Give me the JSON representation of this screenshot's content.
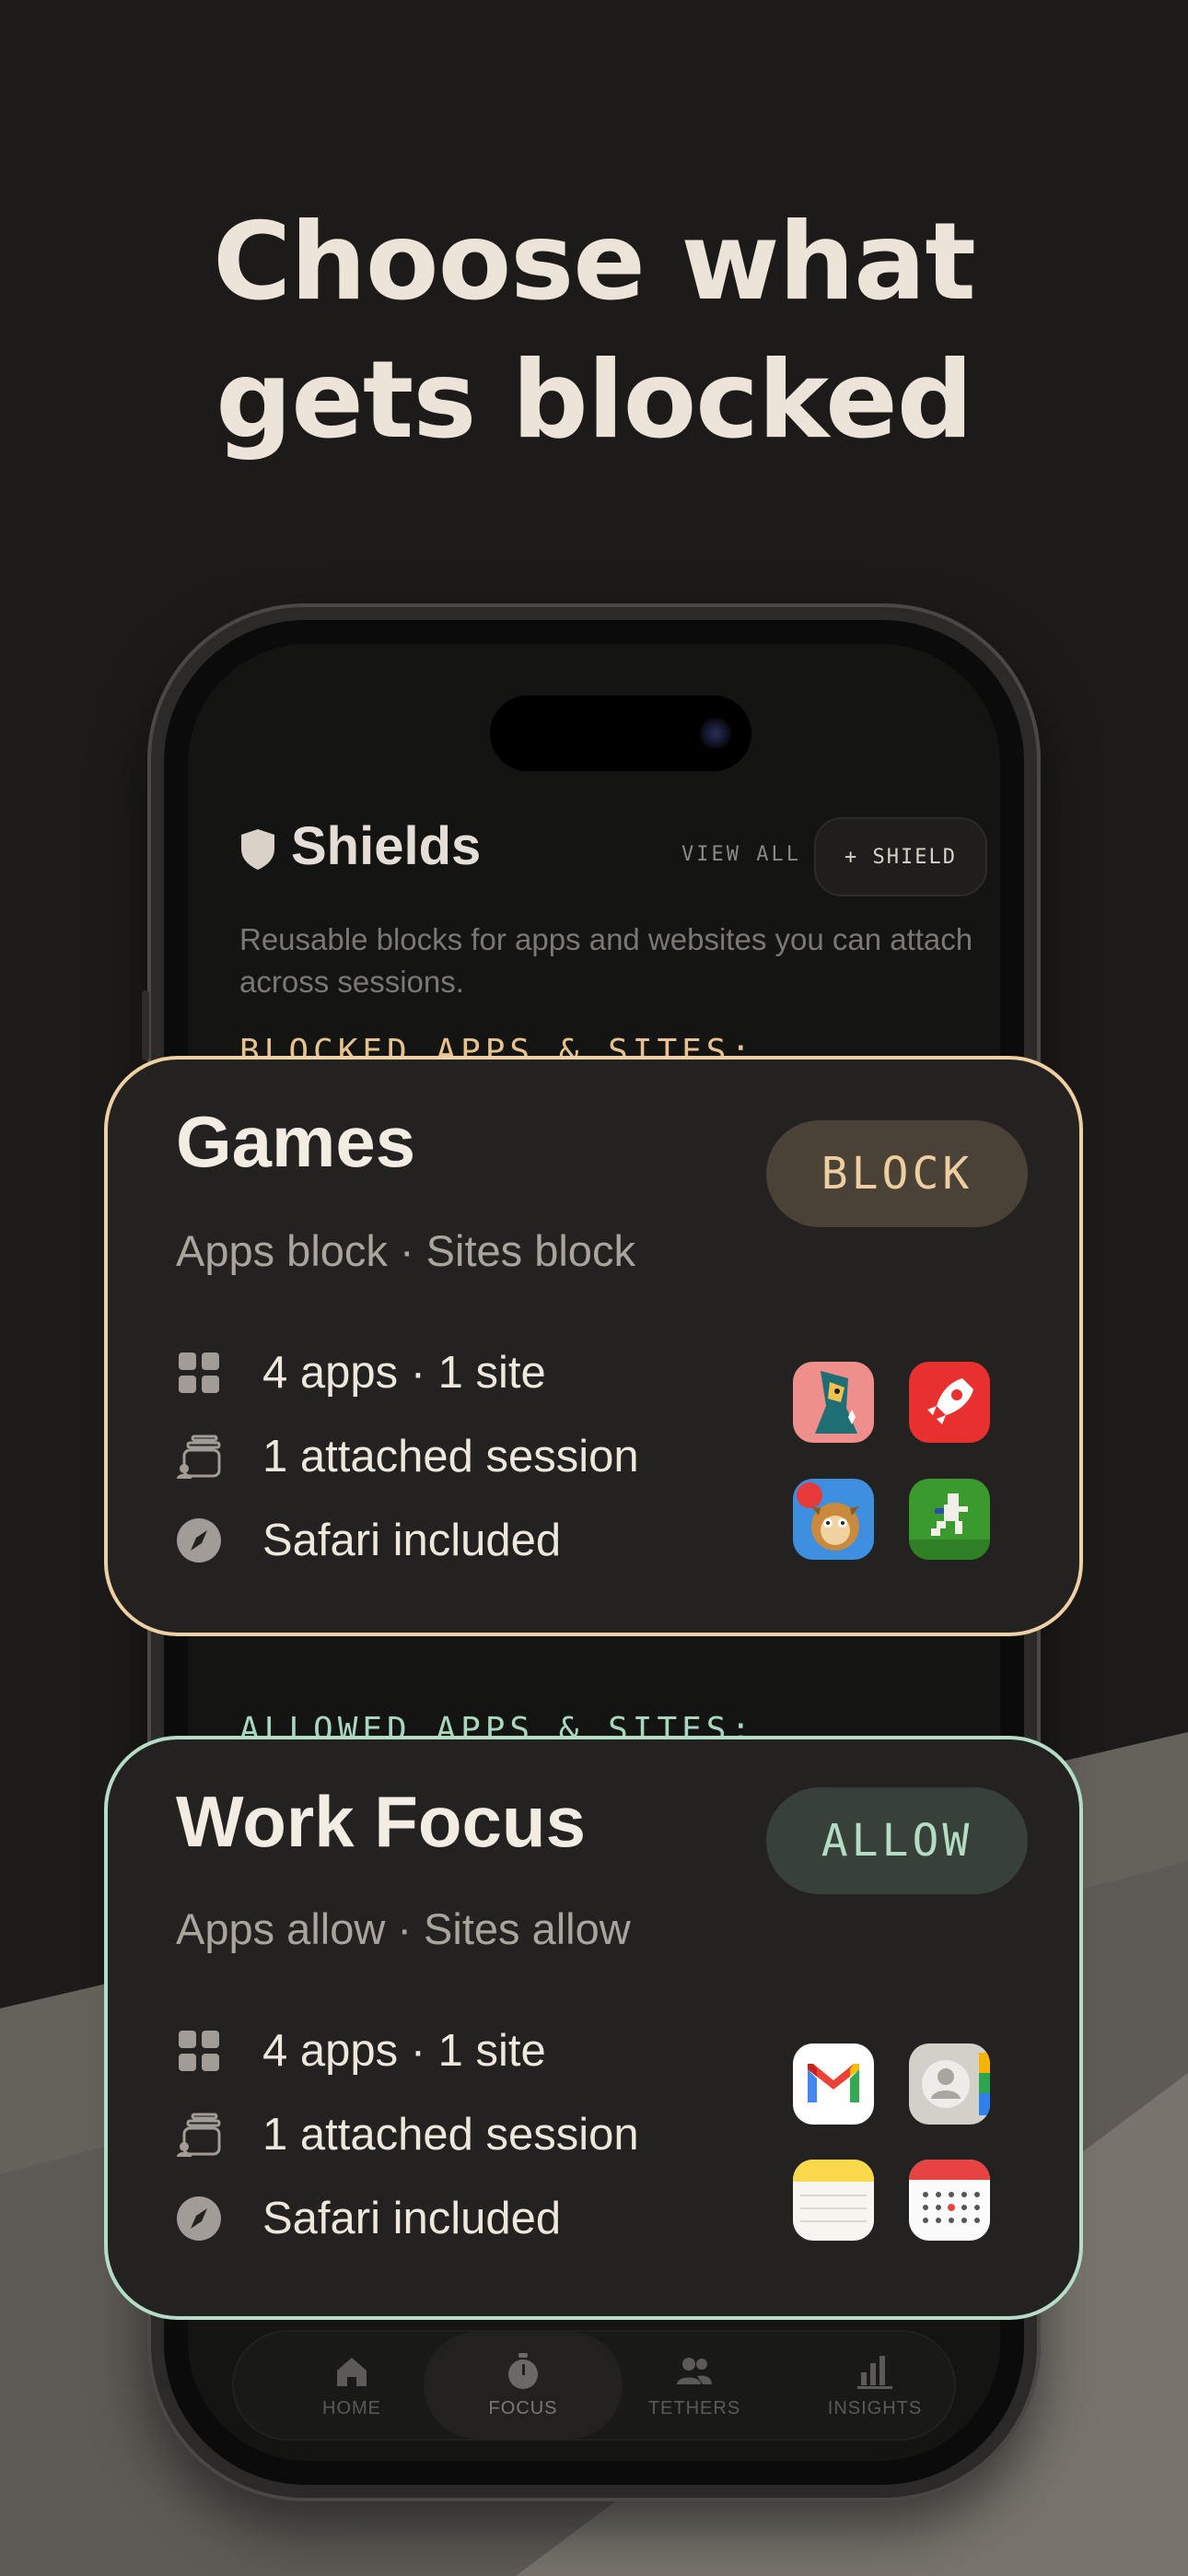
{
  "headline": {
    "line1": "Choose what",
    "line2": "gets blocked"
  },
  "screen": {
    "title": "Shields",
    "view_all": "VIEW ALL",
    "add_shield": "+ SHIELD",
    "description": "Reusable blocks for apps and websites you can attach across sessions.",
    "blocked_label": "BLOCKED APPS & SITES:",
    "allowed_label": "ALLOWED APPS & SITES:",
    "tabs": [
      {
        "label": "HOME",
        "icon": "home-icon"
      },
      {
        "label": "FOCUS",
        "icon": "stopwatch-icon"
      },
      {
        "label": "TETHERS",
        "icon": "people-icon"
      },
      {
        "label": "INSIGHTS",
        "icon": "bar-chart-icon"
      }
    ]
  },
  "cards": {
    "games": {
      "title": "Games",
      "mode": "BLOCK",
      "subtitle": "Apps block · Sites block",
      "apps_sites": "4 apps · 1 site",
      "sessions": "1 attached session",
      "safari": "Safari included",
      "apps": [
        "monument-valley-icon",
        "rocket-game-icon",
        "bloons-td-icon",
        "pixel-runner-icon"
      ]
    },
    "work": {
      "title": "Work Focus",
      "mode": "ALLOW",
      "subtitle": "Apps allow · Sites allow",
      "apps_sites": "4 apps · 1 site",
      "sessions": "1 attached session",
      "safari": "Safari included",
      "apps": [
        "gmail-icon",
        "contacts-icon",
        "notes-icon",
        "calendar-icon"
      ]
    }
  },
  "colors": {
    "block_accent": "#efcfa4",
    "allow_accent": "#b5dcc4",
    "background": "#1c1b1a"
  }
}
